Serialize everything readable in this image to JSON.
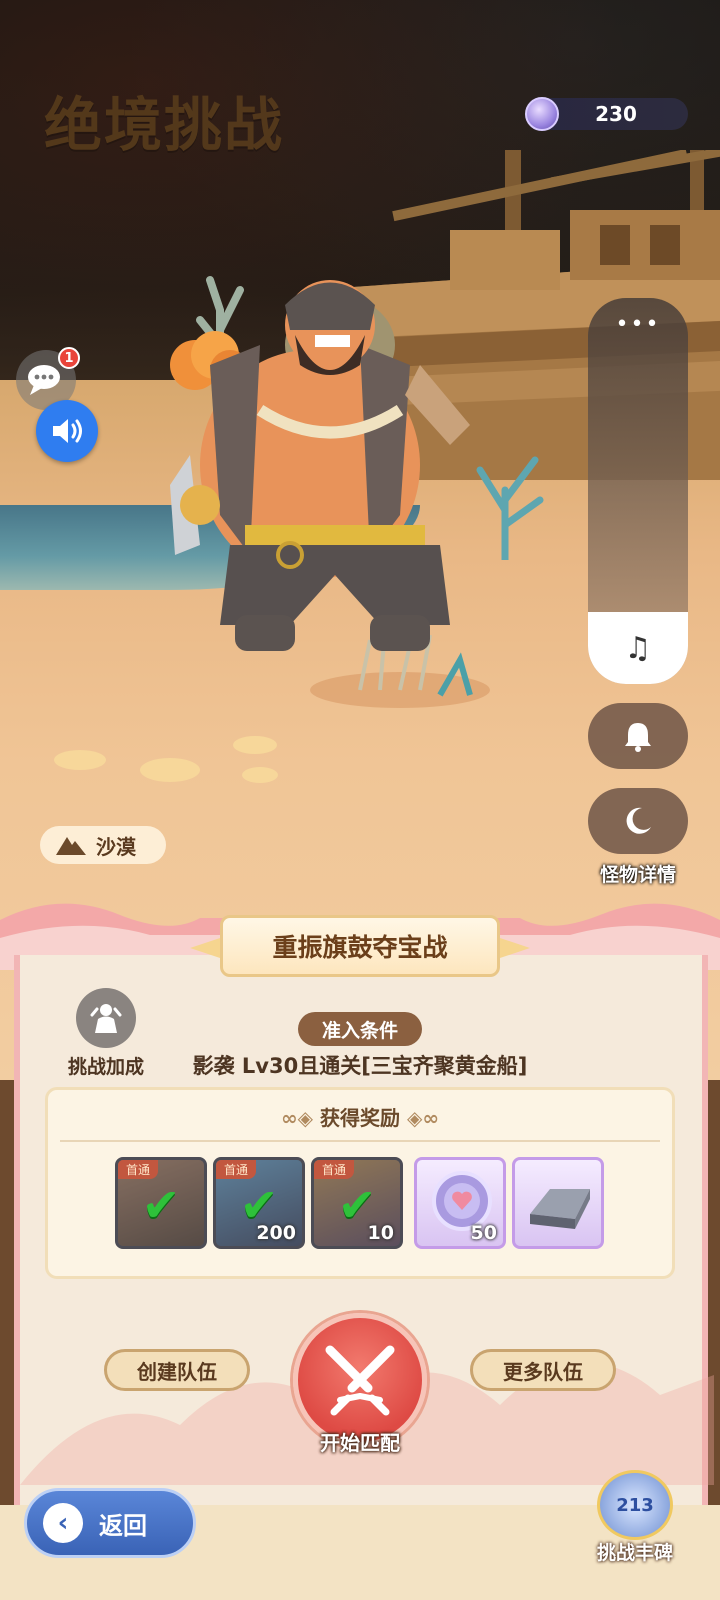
{
  "header": {
    "title": "绝境挑战",
    "currency_amount": "230",
    "currency_icon": "crystal-coin-icon"
  },
  "chat": {
    "badge": "1"
  },
  "side_panel": {
    "more": "•••",
    "music_icon": "♫",
    "bell_icon": "🔔",
    "moon_icon": "☾"
  },
  "monster_detail_label": "怪物详情",
  "terrain": {
    "label": "沙漠",
    "icon": "mountain-icon"
  },
  "event": {
    "title": "重振旗鼓夺宝战"
  },
  "challenge_bonus_label": "挑战加成",
  "entry": {
    "title": "准入条件",
    "text": "影袭  Lv30且通关[三宝齐聚黄金船]"
  },
  "rewards": {
    "title": "获得奖励",
    "items": [
      {
        "tag": "首通",
        "qty": "",
        "claimed": true,
        "icon": "pirate-chest-icon"
      },
      {
        "tag": "首通",
        "qty": "200",
        "claimed": true,
        "icon": "crystal-shard-icon"
      },
      {
        "tag": "首通",
        "qty": "10",
        "claimed": true,
        "icon": "token-icon"
      },
      {
        "tag": "",
        "qty": "50",
        "claimed": false,
        "icon": "heart-coin-icon"
      },
      {
        "tag": "",
        "qty": "",
        "claimed": false,
        "icon": "iron-ingot-icon"
      }
    ]
  },
  "actions": {
    "create_team": "创建队伍",
    "more_teams": "更多队伍",
    "start_match": "开始匹配"
  },
  "footer": {
    "back": "返回",
    "trophy": "挑战丰碑",
    "podium": "213"
  },
  "colors": {
    "accent_blue": "#3a63b6",
    "match_red": "#de4a44",
    "card_bg": "#f5eadb"
  }
}
